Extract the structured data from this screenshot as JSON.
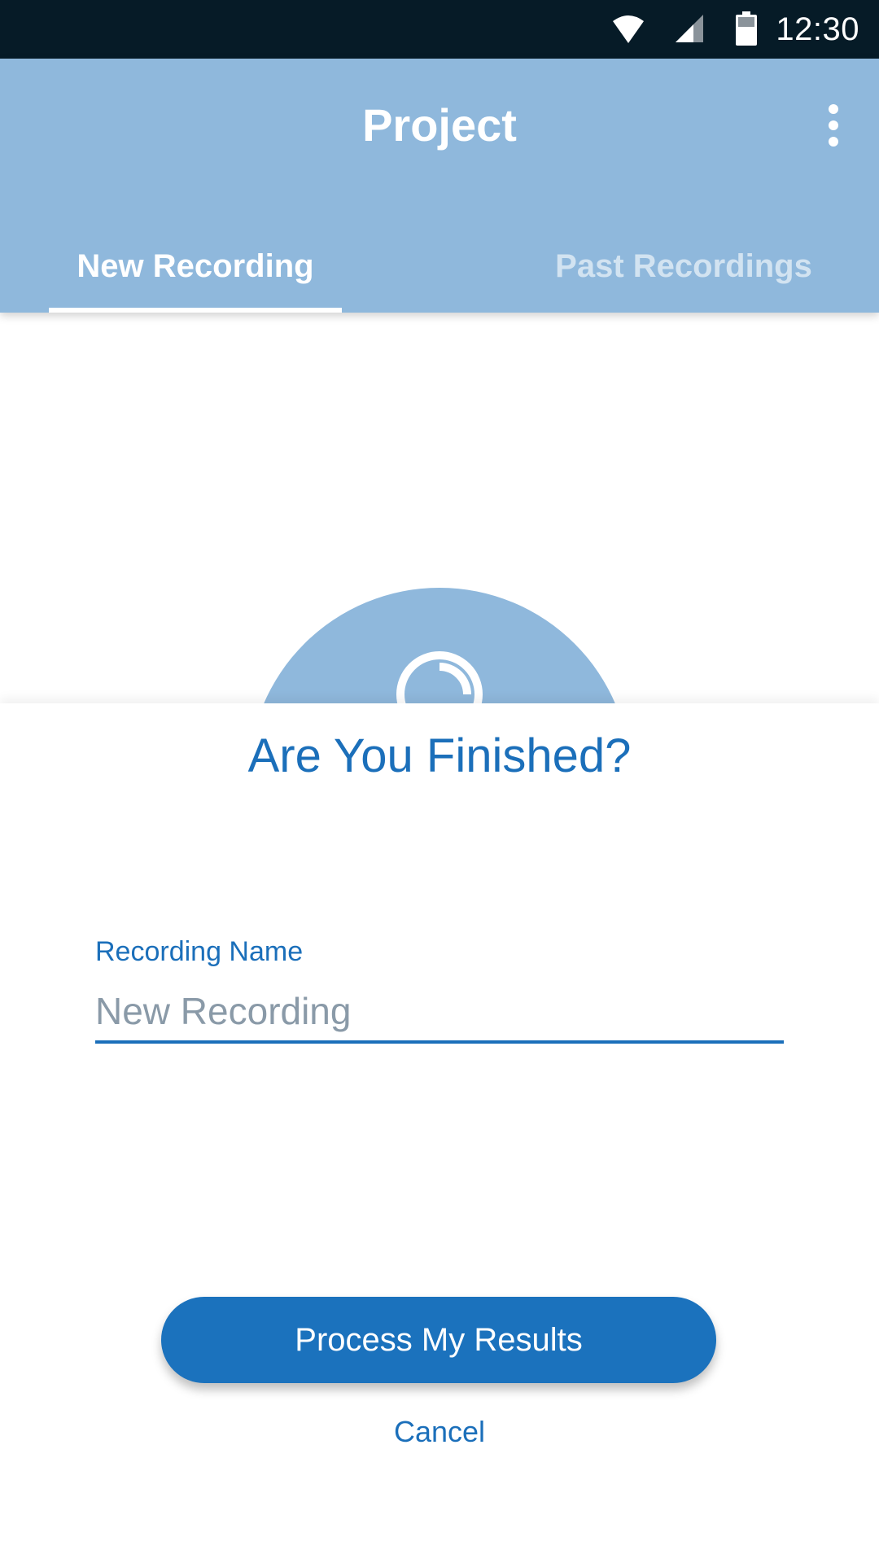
{
  "status_bar": {
    "time": "12:30",
    "icons": [
      "wifi-icon",
      "cell-signal-icon",
      "battery-icon"
    ]
  },
  "app_bar": {
    "title": "Project",
    "menu_icon": "more-vert-icon",
    "tabs": [
      {
        "label": "New Recording",
        "selected": true
      },
      {
        "label": "Past Recordings",
        "selected": false
      }
    ]
  },
  "recording": {
    "icon": "recording-progress-icon"
  },
  "dialog": {
    "title": "Are You Finished?",
    "name_field": {
      "label": "Recording Name",
      "placeholder": "New Recording",
      "value": ""
    },
    "primary_button": "Process My Results",
    "cancel_button": "Cancel"
  },
  "colors": {
    "status_bar_bg": "#061b27",
    "app_bar_bg": "#8fb8dc",
    "accent": "#1b72bd",
    "text_blue": "#1b6fba"
  }
}
